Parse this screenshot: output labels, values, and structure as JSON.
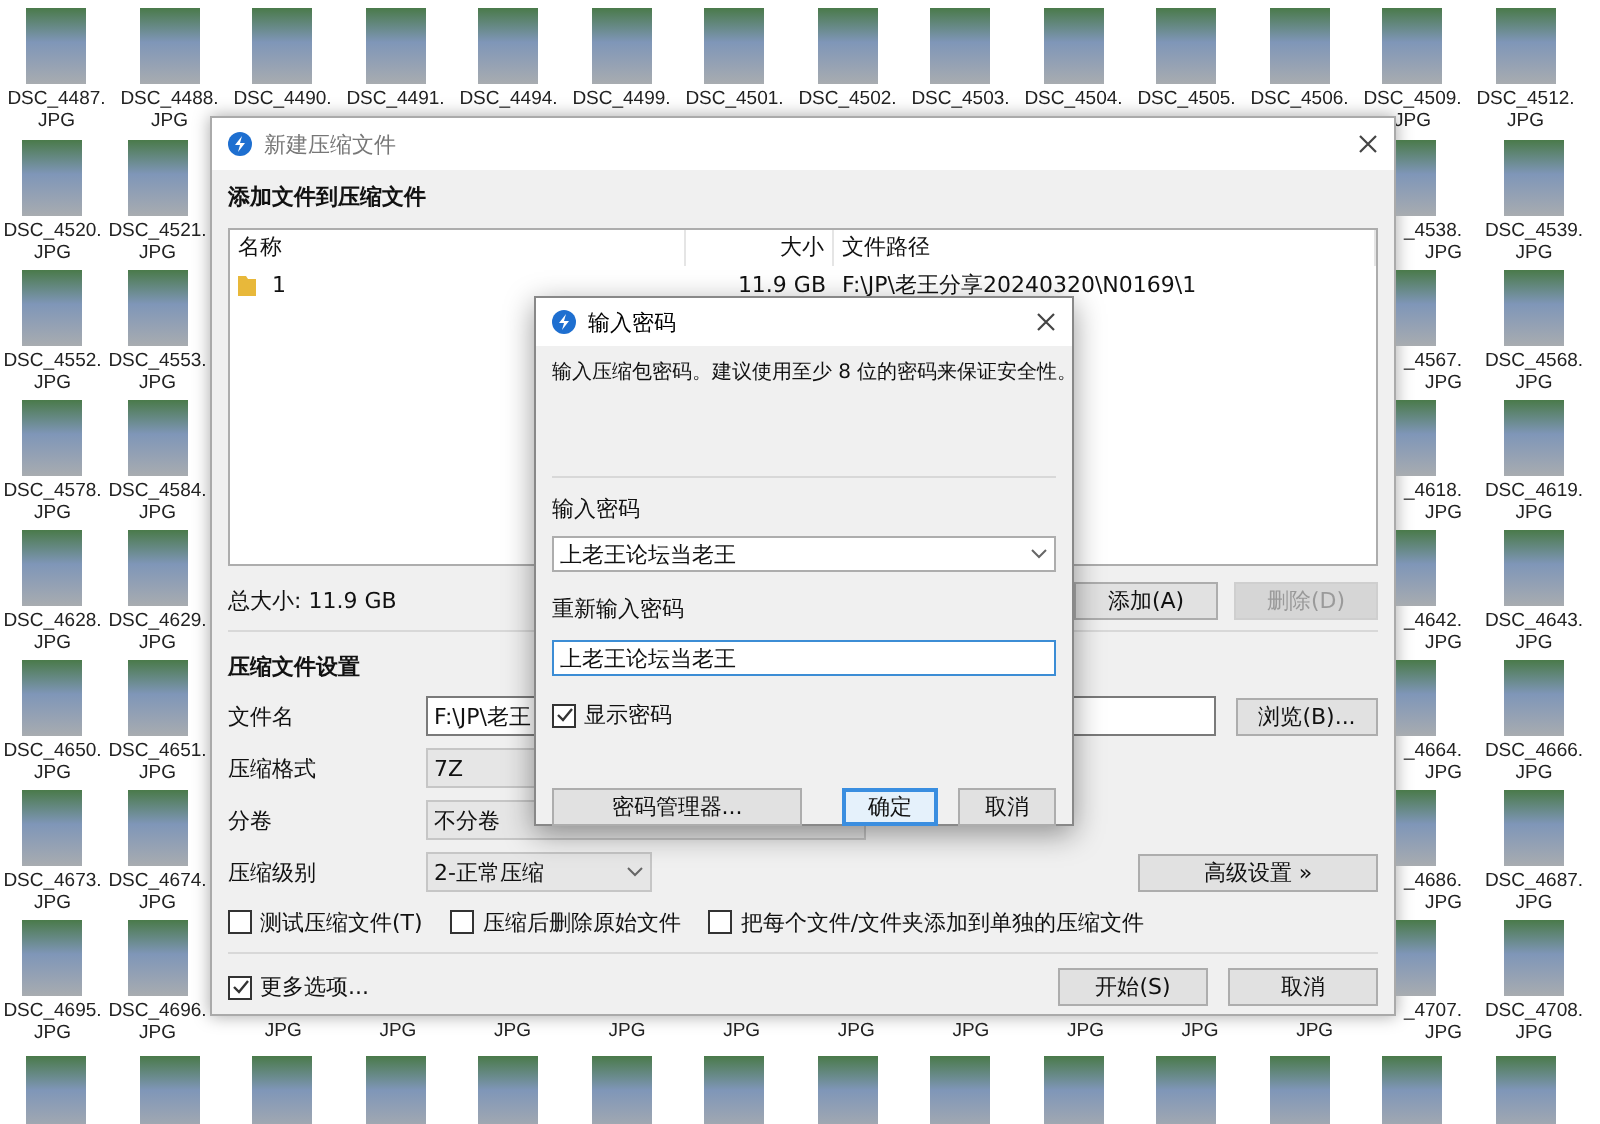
{
  "desktop": {
    "top_row": [
      {
        "name": "DSC_4487.",
        "ext": "JPG"
      },
      {
        "name": "DSC_4488.",
        "ext": "JPG"
      },
      {
        "name": "DSC_4490."
      },
      {
        "name": "DSC_4491."
      },
      {
        "name": "DSC_4494."
      },
      {
        "name": "DSC_4499."
      },
      {
        "name": "DSC_4501."
      },
      {
        "name": "DSC_4502."
      },
      {
        "name": "DSC_4503."
      },
      {
        "name": "DSC_4504."
      },
      {
        "name": "DSC_4505."
      },
      {
        "name": "DSC_4506."
      },
      {
        "name": "DSC_4509.",
        "ext": "JPG"
      },
      {
        "name": "DSC_4512.",
        "ext": "JPG"
      }
    ],
    "left_rows": [
      [
        {
          "name": "DSC_4520.",
          "ext": "JPG"
        },
        {
          "name": "DSC_4521.",
          "ext": "JPG"
        }
      ],
      [
        {
          "name": "DSC_4552.",
          "ext": "JPG"
        },
        {
          "name": "DSC_4553.",
          "ext": "JPG"
        }
      ],
      [
        {
          "name": "DSC_4578.",
          "ext": "JPG"
        },
        {
          "name": "DSC_4584.",
          "ext": "JPG"
        }
      ],
      [
        {
          "name": "DSC_4628.",
          "ext": "JPG"
        },
        {
          "name": "DSC_4629.",
          "ext": "JPG"
        }
      ],
      [
        {
          "name": "DSC_4650.",
          "ext": "JPG"
        },
        {
          "name": "DSC_4651.",
          "ext": "JPG"
        }
      ],
      [
        {
          "name": "DSC_4673.",
          "ext": "JPG"
        },
        {
          "name": "DSC_4674.",
          "ext": "JPG"
        }
      ],
      [
        {
          "name": "DSC_4695.",
          "ext": "JPG"
        },
        {
          "name": "DSC_4696.",
          "ext": "JPG"
        }
      ]
    ],
    "right_rows": [
      [
        {
          "name": "_4538.",
          "ext": "JPG"
        },
        {
          "name": "DSC_4539.",
          "ext": "JPG"
        }
      ],
      [
        {
          "name": "_4567.",
          "ext": "JPG"
        },
        {
          "name": "DSC_4568.",
          "ext": "JPG"
        }
      ],
      [
        {
          "name": "_4618.",
          "ext": "JPG"
        },
        {
          "name": "DSC_4619.",
          "ext": "JPG"
        }
      ],
      [
        {
          "name": "_4642.",
          "ext": "JPG"
        },
        {
          "name": "DSC_4643.",
          "ext": "JPG"
        }
      ],
      [
        {
          "name": "_4664.",
          "ext": "JPG"
        },
        {
          "name": "DSC_4666.",
          "ext": "JPG"
        }
      ],
      [
        {
          "name": "_4686.",
          "ext": "JPG"
        },
        {
          "name": "DSC_4687.",
          "ext": "JPG"
        }
      ],
      [
        {
          "name": "_4707.",
          "ext": "JPG"
        },
        {
          "name": "DSC_4708.",
          "ext": "JPG"
        }
      ]
    ],
    "under_dialog": [
      "JPG",
      "JPG",
      "JPG",
      "JPG",
      "JPG",
      "JPG",
      "JPG",
      "JPG",
      "JPG",
      "JPG"
    ]
  },
  "archive_dialog": {
    "title": "新建压缩文件",
    "files_heading": "添加文件到压缩文件",
    "file_list": {
      "columns": [
        "名称",
        "大小",
        "文件路径"
      ],
      "rows": [
        {
          "name": "1",
          "size": "11.9 GB",
          "path": "F:\\JP\\老王分享20240320\\N0169\\1"
        }
      ]
    },
    "total_size": "总大小: 11.9 GB",
    "list_buttons": [
      {
        "label": "添加(A)",
        "disabled": false
      },
      {
        "label": "删除(D)",
        "disabled": true
      }
    ],
    "settings_heading": "压缩文件设置",
    "fields": [
      {
        "label": "文件名",
        "kind": "text",
        "value": "F:\\JP\\老王",
        "button": "浏览(B)..."
      },
      {
        "label": "压缩格式",
        "kind": "select",
        "value": "7Z"
      },
      {
        "label": "分卷",
        "kind": "select",
        "value": "不分卷"
      },
      {
        "label": "压缩级别",
        "kind": "dropdown",
        "value": "2-正常压缩",
        "button": "高级设置 »"
      }
    ],
    "options": [
      {
        "label": "测试压缩文件(T)",
        "checked": false
      },
      {
        "label": "压缩后删除原始文件",
        "checked": false
      },
      {
        "label": "把每个文件/文件夹添加到单独的压缩文件",
        "checked": false
      }
    ],
    "more_options": {
      "label": "更多选项...",
      "checked": true
    },
    "buttons": [
      "开始(S)",
      "取消"
    ]
  },
  "password_dialog": {
    "title": "输入密码",
    "hint": "输入压缩包密码。建议使用至少 8 位的密码来保证安全性。",
    "password_label": "输入密码",
    "password": "上老王论坛当老王",
    "confirm_label": "重新输入密码",
    "confirm": "上老王论坛当老王",
    "show_password": {
      "label": "显示密码",
      "checked": true
    },
    "buttons": [
      {
        "label": "密码管理器...",
        "default": false
      },
      {
        "label": "确定",
        "default": true
      },
      {
        "label": "取消",
        "default": false
      }
    ]
  }
}
